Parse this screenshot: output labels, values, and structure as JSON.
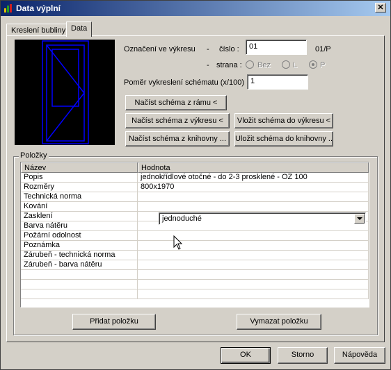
{
  "window": {
    "title": "Data výplní",
    "close_glyph": "✕"
  },
  "tabs": [
    {
      "label": "Kreslení bubliny"
    },
    {
      "label": "Data"
    }
  ],
  "form": {
    "oznaceni_label": "Označení ve výkresu",
    "dash1": "-",
    "cislo_label": "číslo :",
    "cislo_value": "01",
    "cislo_suffix": "01/P",
    "dash2": "-",
    "strana_label": "strana :",
    "radio_bez": "Bez",
    "radio_l": "L",
    "radio_p": "P",
    "pomer_label": "Poměr vykreslení schématu (x/100)",
    "pomer_value": "1"
  },
  "buttons": {
    "nacist_ram": "Načíst schéma z rámu <",
    "nacist_vykres": "Načíst schéma z výkresu <",
    "vlozit_vykres": "Vložit schéma do výkresu <",
    "nacist_knihovna": "Načíst schéma z knihovny ...",
    "vlozit_knihovna": "Uložit schéma do knihovny ...",
    "pridat": "Přidat položku",
    "vymazat": "Vymazat položku",
    "ok": "OK",
    "storno": "Storno",
    "napoveda": "Nápověda"
  },
  "group": {
    "label": "Položky"
  },
  "grid": {
    "headers": {
      "nazev": "Název",
      "hodnota": "Hodnota"
    },
    "rows": [
      {
        "nazev": "Popis",
        "hodnota": "jednokřídlové otočné - do 2-3 prosklené - OZ 100"
      },
      {
        "nazev": "Rozměry",
        "hodnota": "800x1970"
      },
      {
        "nazev": "Technická norma",
        "hodnota": ""
      },
      {
        "nazev": "Kování",
        "hodnota": ""
      },
      {
        "nazev": "Zasklení",
        "hodnota": "jednoduché"
      },
      {
        "nazev": "Barva nátěru",
        "hodnota": ""
      },
      {
        "nazev": "Požární odolnost",
        "hodnota": ""
      },
      {
        "nazev": "Poznámka",
        "hodnota": ""
      },
      {
        "nazev": "Zárubeň - technická norma",
        "hodnota": ""
      },
      {
        "nazev": "Zárubeň - barva nátěru",
        "hodnota": ""
      },
      {
        "nazev": "",
        "hodnota": ""
      },
      {
        "nazev": "",
        "hodnota": ""
      },
      {
        "nazev": "",
        "hodnota": ""
      }
    ]
  },
  "colors": {
    "title_start": "#0a246a",
    "title_end": "#a6caf0",
    "preview_bg": "#000000",
    "preview_lines": "#0000ff",
    "face": "#d4d0c8"
  }
}
